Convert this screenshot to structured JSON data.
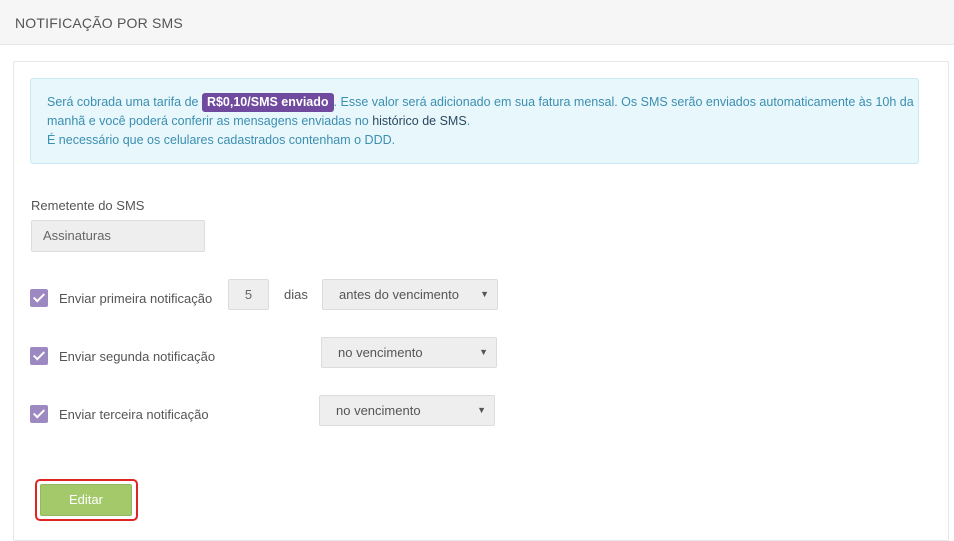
{
  "header": {
    "title": "NOTIFICAÇÃO POR SMS"
  },
  "alert": {
    "prefix": "Será cobrada uma tarifa de ",
    "price": "R$0,10/SMS enviado",
    "line1_rest": ". Esse valor será adicionado em sua fatura mensal. Os SMS serão enviados automaticamente às 10h da",
    "line2_start": "manhã e você poderá conferir as mensagens enviadas no ",
    "history_link": "histórico de SMS",
    "line2_end": ".",
    "line3": "É necessário que os celulares cadastrados contenham o DDD."
  },
  "sender": {
    "label": "Remetente do SMS",
    "value": "Assinaturas"
  },
  "notifications": [
    {
      "label": "Enviar primeira notificação",
      "checked": true,
      "days": "5",
      "days_unit": "dias",
      "timing": "antes do vencimento"
    },
    {
      "label": "Enviar segunda notificação",
      "checked": true,
      "timing": "no vencimento"
    },
    {
      "label": "Enviar terceira notificação",
      "checked": true,
      "timing": "no vencimento"
    }
  ],
  "actions": {
    "edit_label": "Editar"
  },
  "colors": {
    "accent": "#6f4a9e",
    "checkbox": "#9d89c2",
    "button": "#a3c96b",
    "highlight": "#e02424"
  }
}
